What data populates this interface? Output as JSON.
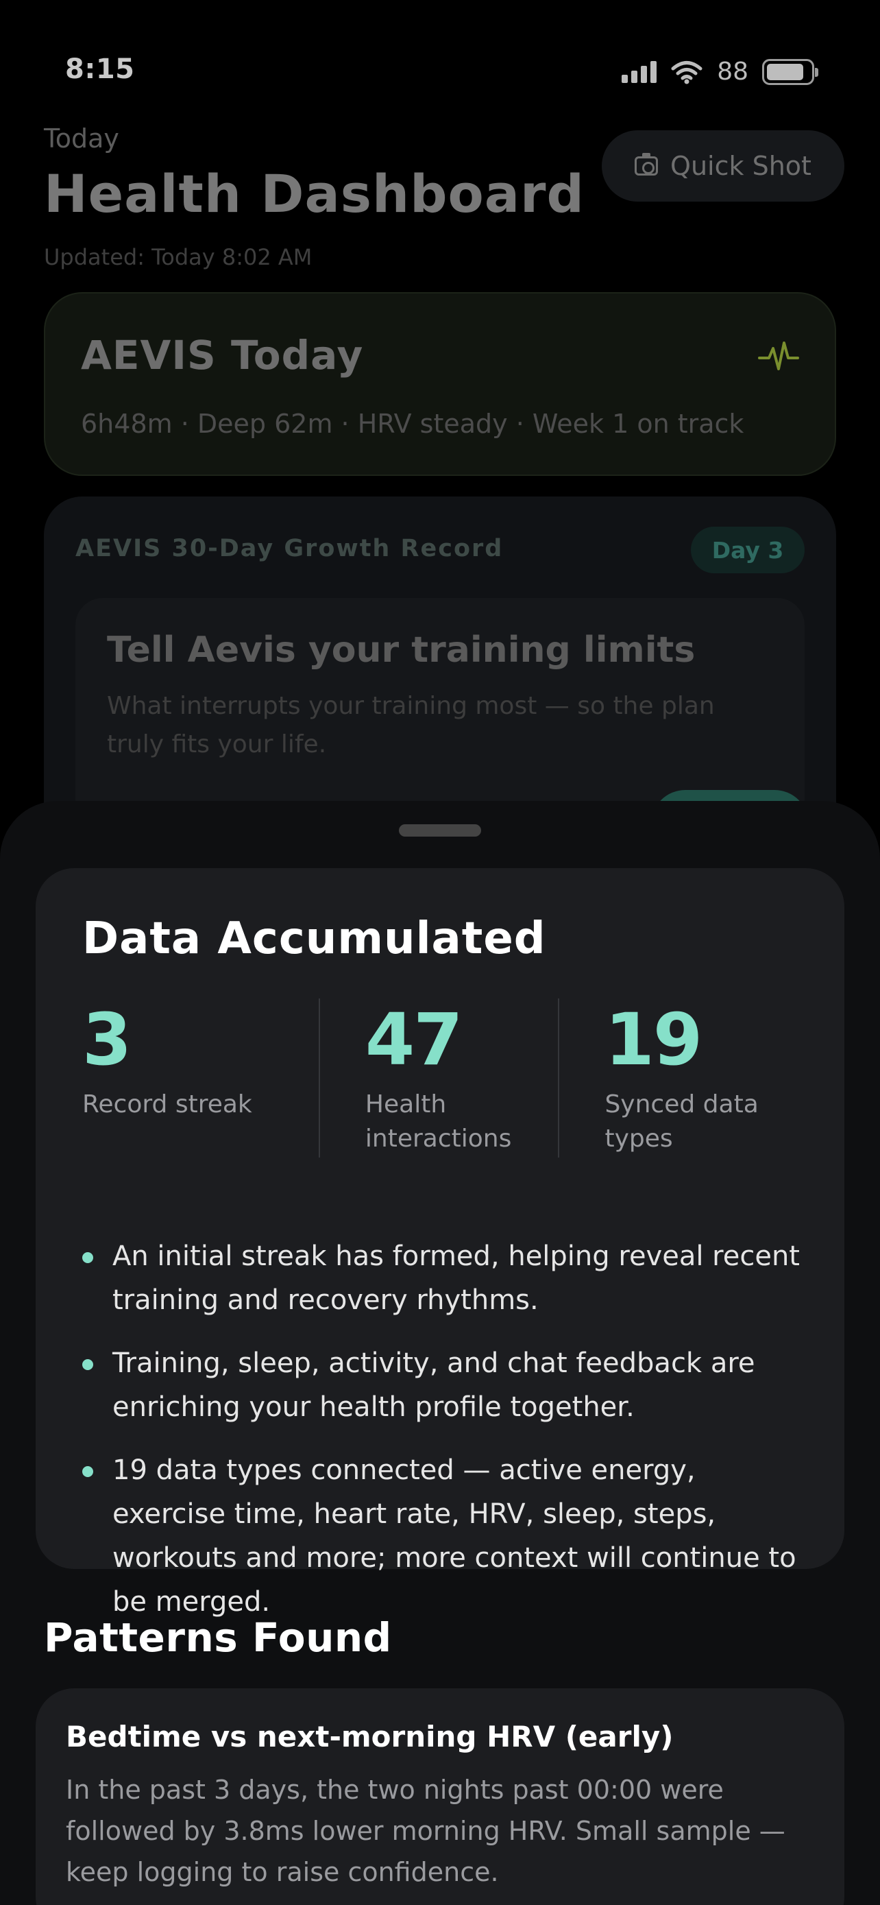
{
  "status_bar": {
    "time": "8:15",
    "battery_percent": "88",
    "icons": [
      "signal-icon",
      "wifi-icon",
      "battery-icon"
    ]
  },
  "header": {
    "subtitle": "Today",
    "title": "Health Dashboard",
    "updated": "Updated: Today 8:02 AM",
    "quick_shot_label": "Quick Shot",
    "quick_shot_icon": "camera-icon"
  },
  "today_card": {
    "title": "AEVIS Today",
    "icon": "pulse-icon",
    "meta": "6h48m · Deep 62m · HRV steady · Week 1 on track",
    "accent_color": "#7a8f2e"
  },
  "growth_card": {
    "title": "AEVIS 30-Day Growth Record",
    "day_badge": "Day 3",
    "task_title": "Tell Aevis your training limits",
    "task_body": "What interrupts your training most — so the plan truly fits your life."
  },
  "sheet": {
    "accumulated": {
      "title": "Data Accumulated",
      "stats": [
        {
          "value": "3",
          "label": "Record streak"
        },
        {
          "value": "47",
          "label": "Health interactions"
        },
        {
          "value": "19",
          "label": "Synced data types"
        }
      ],
      "bullets": [
        "An initial streak has formed, helping reveal recent training and recovery rhythms.",
        "Training, sleep, activity, and chat feedback are enriching your health profile together.",
        "19 data types connected — active energy, exercise time, heart rate, HRV, sleep, steps, workouts and more; more context will continue to be merged."
      ],
      "accent_color": "#86e0c9"
    },
    "patterns": {
      "title": "Patterns Found",
      "items": [
        {
          "heading": "Bedtime vs next-morning HRV (early)",
          "body": "In the past 3 days, the two nights past 00:00 were followed by 3.8ms lower morning HRV. Small sample — keep logging to raise confidence."
        }
      ]
    }
  }
}
